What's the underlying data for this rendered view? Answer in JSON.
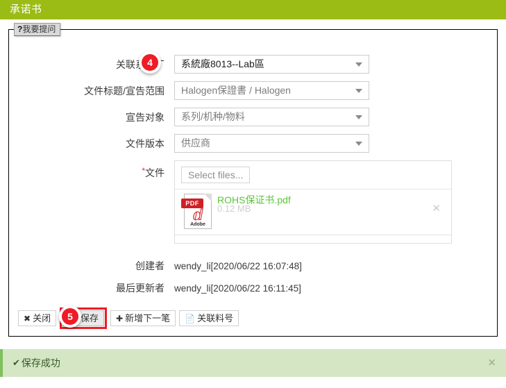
{
  "window": {
    "title": "承诺书",
    "header_bg": "#9bbb15"
  },
  "panel": {
    "ask_tab": {
      "qmark": "?",
      "label": "我要提问"
    }
  },
  "form": {
    "fields": [
      {
        "label": "关联系统厂",
        "value": "系統廠8013--Lab區",
        "filled": true
      },
      {
        "label": "文件标题/宣告范围",
        "value": "Halogen保證書 / Halogen",
        "filled": false
      },
      {
        "label": "宣告对象",
        "value": "系列/机种/物料",
        "filled": false
      },
      {
        "label": "文件版本",
        "value": "供应商",
        "filled": false
      }
    ],
    "file_field": {
      "required_mark": "*",
      "label": "文件",
      "select_button": "Select files...",
      "file": {
        "icon": "pdf-icon",
        "icon_badge": "PDF",
        "icon_brand": "Adobe",
        "name": "ROHS保证书.pdf",
        "size": "0.12 MB",
        "remove_icon": "✕",
        "name_color": "#5cc43a"
      }
    },
    "meta": [
      {
        "label": "创建者",
        "value": "wendy_li[2020/06/22 16:07:48]"
      },
      {
        "label": "最后更新者",
        "value": "wendy_li[2020/06/22 16:11:45]"
      }
    ]
  },
  "buttons": [
    {
      "icon": "✖",
      "label": "关闭",
      "highlighted": false
    },
    {
      "icon": "💾",
      "label": "保存",
      "highlighted": true
    },
    {
      "icon": "✚",
      "label": "新增下一笔",
      "highlighted": false
    },
    {
      "icon": "📄",
      "label": "关联料号",
      "highlighted": false
    }
  ],
  "badges": [
    {
      "number": "4"
    },
    {
      "number": "5"
    }
  ],
  "status": {
    "check_icon": "✔",
    "message": "保存成功",
    "close_icon": "✕",
    "bg": "#d4e6c4",
    "accent": "#7fbf5e"
  }
}
